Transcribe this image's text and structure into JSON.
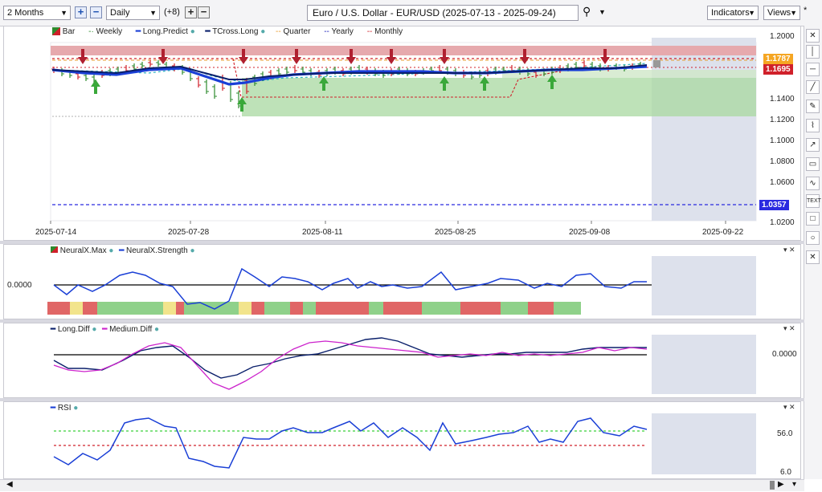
{
  "toolbar": {
    "range_value": "2 Months",
    "interval_value": "Daily",
    "extra_count": "(+8)",
    "chart_title": "Euro / U.S. Dollar - EUR/USD (2025-07-13 - 2025-09-24)",
    "indicators_label": "Indicators",
    "views_label": "Views",
    "asterisk": "*"
  },
  "main_legend": [
    {
      "label": "Bar",
      "color": "#2e8b2e"
    },
    {
      "label": "Weekly",
      "color": "#2e8b2e"
    },
    {
      "label": "Long.Predict",
      "color": "#1a3fd6"
    },
    {
      "label": "TCross.Long",
      "color": "#0a1f6b"
    },
    {
      "label": "Quarter",
      "color": "#e89a2a"
    },
    {
      "label": "Yearly",
      "color": "#1a1fb8"
    },
    {
      "label": "Monthly",
      "color": "#d0202a"
    }
  ],
  "price_axis": [
    "1.2000",
    "1.1800",
    "1.1600",
    "1.1400",
    "1.1200",
    "1.1000",
    "1.0800",
    "1.0600",
    "1.0400",
    "1.0200"
  ],
  "price_badges": {
    "quarter": "1.1787",
    "current": "1.1695",
    "yearly": "1.0357"
  },
  "date_axis": [
    "2025-07-14",
    "2025-07-28",
    "2025-08-11",
    "2025-08-25",
    "2025-09-08",
    "2025-09-22"
  ],
  "neuralx": {
    "legend": [
      "NeuralX.Max",
      "NeuralX.Strength"
    ],
    "axis_label": "0.0000"
  },
  "diff": {
    "legend": [
      "Long.Diff",
      "Medium.Diff"
    ],
    "axis_label": "0.0000"
  },
  "rsi": {
    "legend": [
      "RSI"
    ],
    "axis_top": "56.0",
    "axis_bottom": "6.0"
  },
  "pane_controls": "▾ ✕",
  "colors": {
    "blue": "#1a3fd6",
    "navy": "#0a1f6b",
    "red": "#d0202a",
    "green": "#2e8b2e",
    "magenta": "#cc22cc",
    "orange": "#e89a2a"
  }
}
